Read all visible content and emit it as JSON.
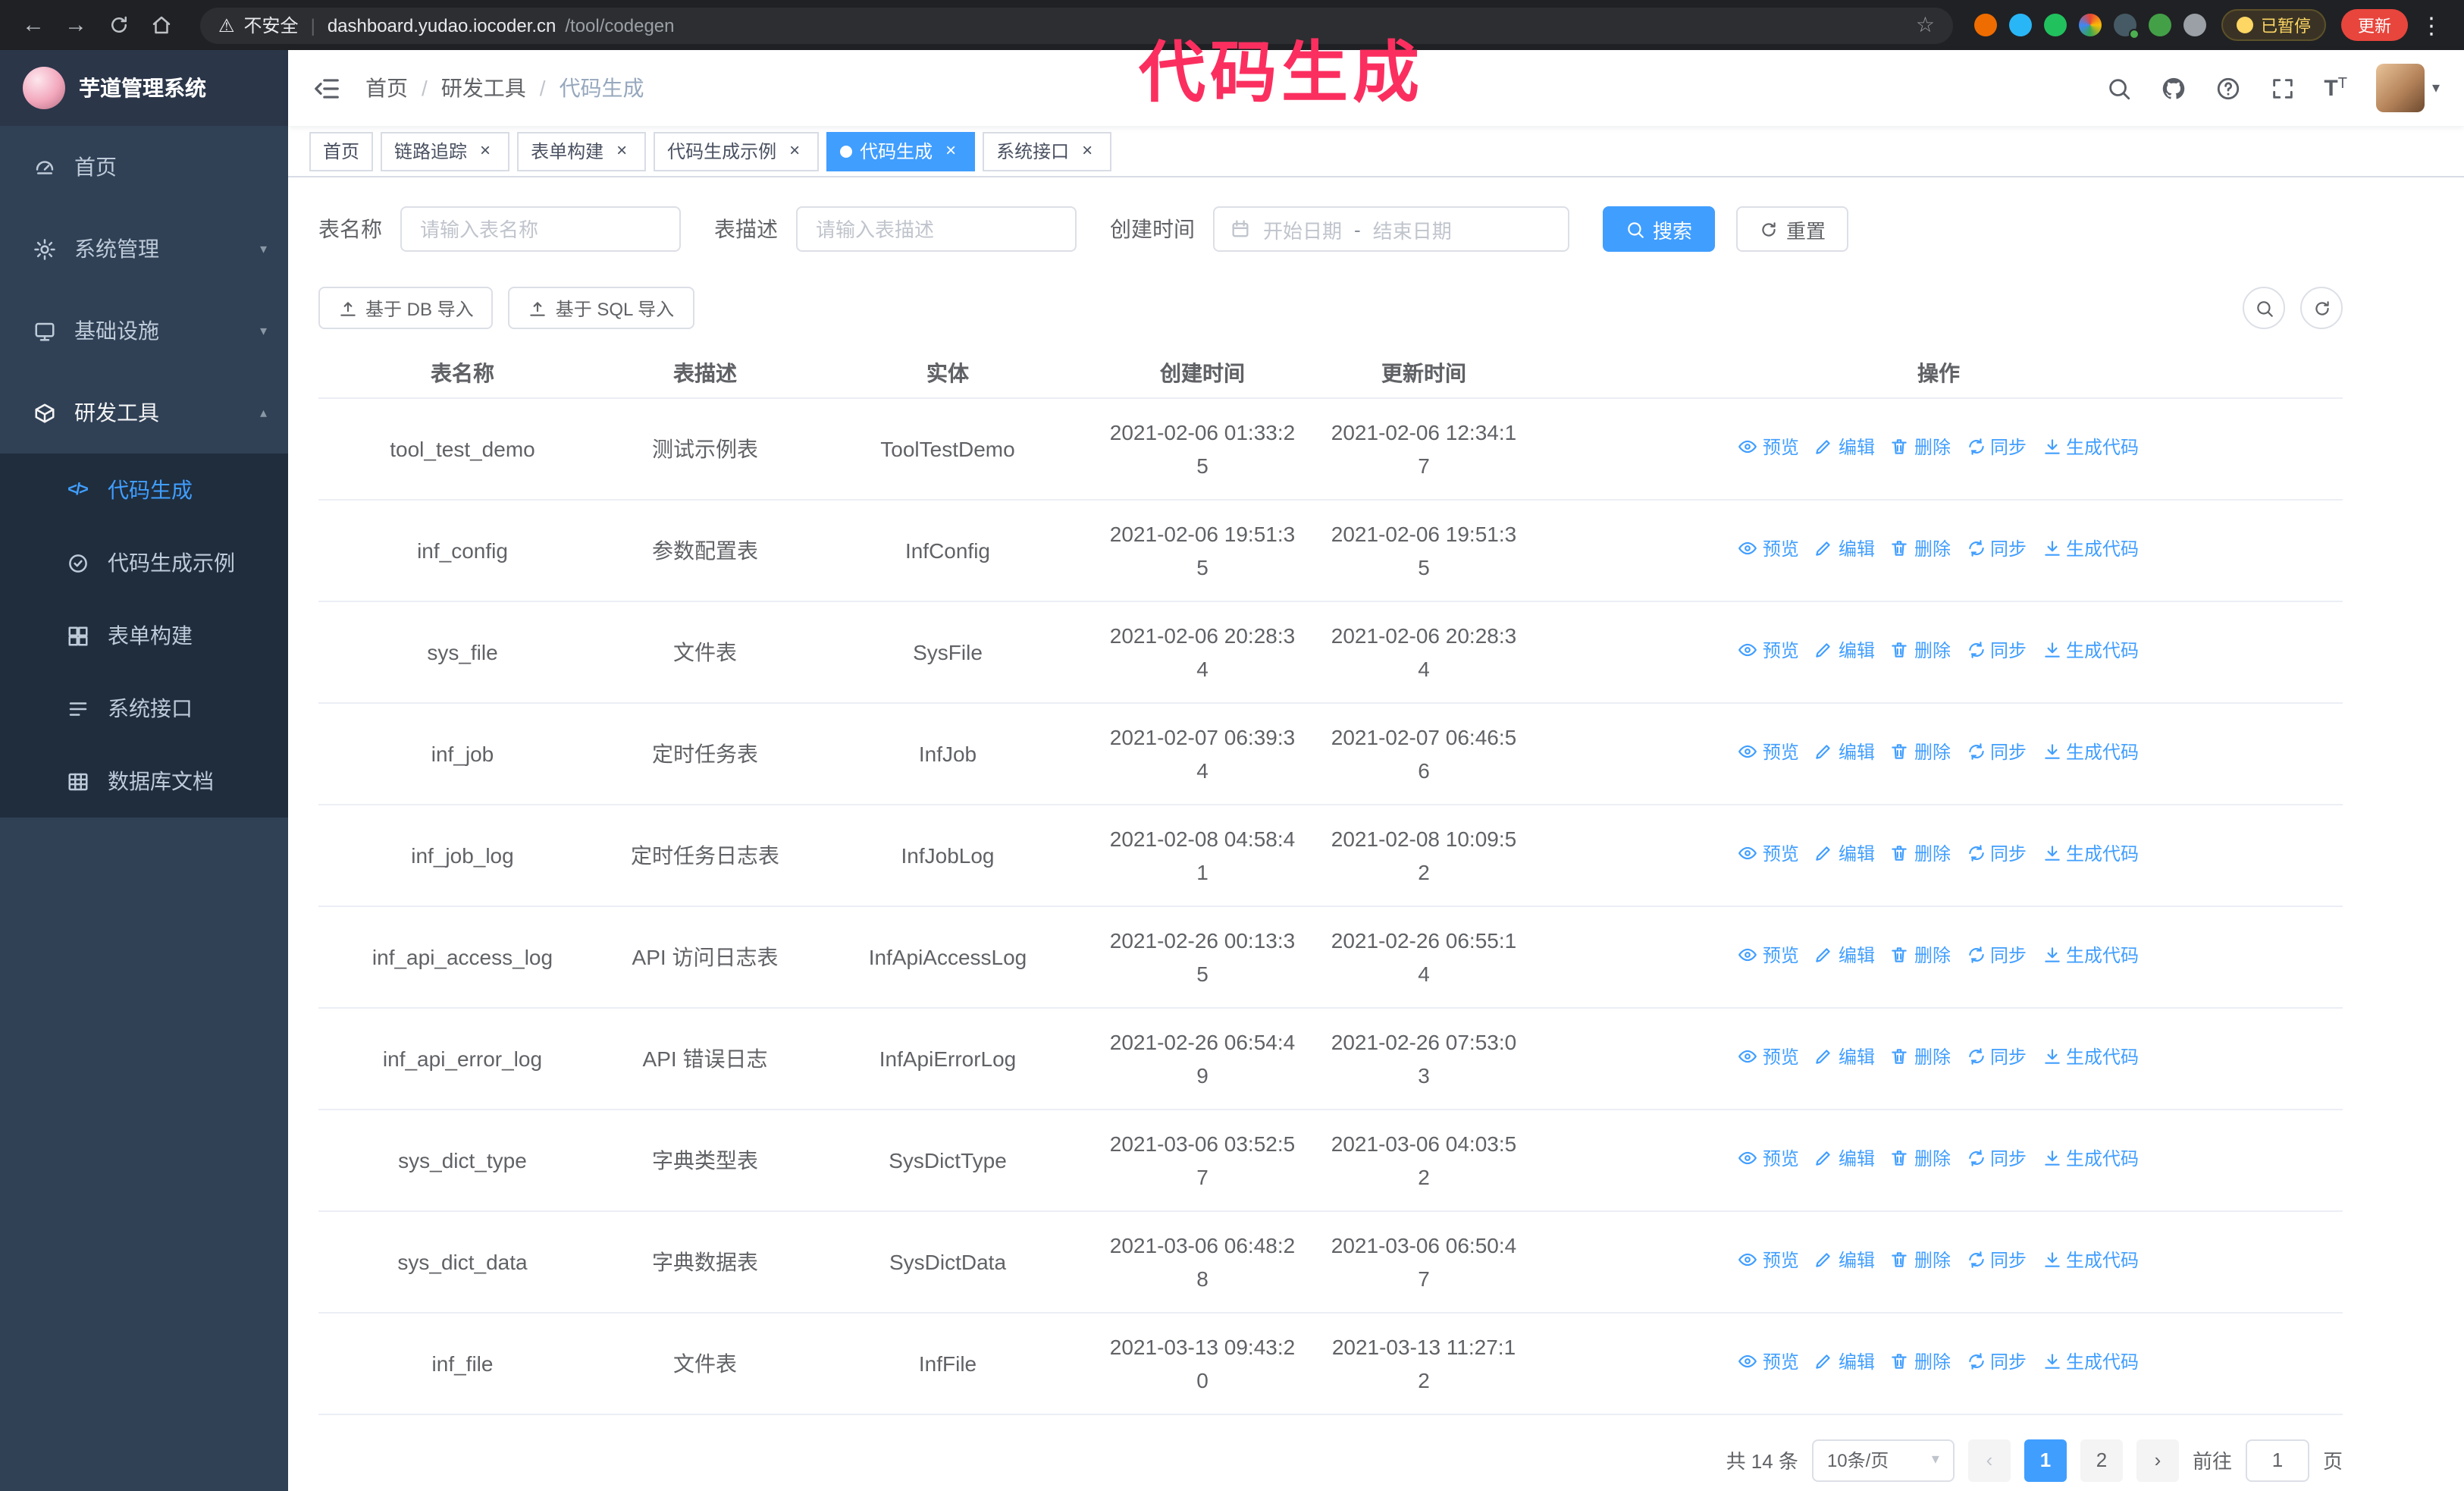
{
  "colors": {
    "accent": "#409eff",
    "annotation": "#fb2f5f",
    "sidebar_bg": "#304156",
    "submenu_bg": "#1f2d3d",
    "tag_active": "#409eff",
    "update_button": "#e8453c",
    "paused_badge": "#fdd663",
    "link": "#409eff"
  },
  "chrome": {
    "security_text": "不安全",
    "url_host": "dashboard.yudao.iocoder.cn",
    "url_path": "/tool/codegen",
    "paused_label": "已暂停",
    "update_label": "更新",
    "extensions": [
      {
        "name": "fox-extension-icon",
        "color": "#ef6c00"
      },
      {
        "name": "drop-extension-icon",
        "color": "#29b6f6"
      },
      {
        "name": "green-check-extension-icon",
        "color": "#21c15e"
      },
      {
        "name": "colorful-extension-icon",
        "color": "conic"
      },
      {
        "name": "badged-extension-icon",
        "color": "#455a64",
        "badge": "#4caf50"
      },
      {
        "name": "leaf-extension-icon",
        "color": "#43a047"
      },
      {
        "name": "pin-extension-icon",
        "color": "#9aa0a6"
      }
    ]
  },
  "overlay": {
    "title": "代码生成"
  },
  "sidebar": {
    "app_title": "芋道管理系统",
    "items": [
      {
        "name": "home",
        "label": "首页",
        "icon": "gauge"
      },
      {
        "name": "system",
        "label": "系统管理",
        "icon": "gear",
        "chevron": "down"
      },
      {
        "name": "infra",
        "label": "基础设施",
        "icon": "monitor",
        "chevron": "down"
      },
      {
        "name": "dev-tools",
        "label": "研发工具",
        "icon": "tool",
        "chevron": "up",
        "expanded": true
      }
    ],
    "subitems": [
      {
        "name": "codegen",
        "label": "代码生成",
        "icon": "code",
        "active": true
      },
      {
        "name": "codegen-demo",
        "label": "代码生成示例",
        "icon": "demo"
      },
      {
        "name": "form-builder",
        "label": "表单构建",
        "icon": "form"
      },
      {
        "name": "api",
        "label": "系统接口",
        "icon": "api"
      },
      {
        "name": "db-doc",
        "label": "数据库文档",
        "icon": "db"
      }
    ]
  },
  "navbar": {
    "breadcrumb": [
      "首页",
      "研发工具",
      "代码生成"
    ]
  },
  "tags": [
    {
      "label": "首页",
      "closable": false,
      "active": false
    },
    {
      "label": "链路追踪",
      "closable": true,
      "active": false
    },
    {
      "label": "表单构建",
      "closable": true,
      "active": false
    },
    {
      "label": "代码生成示例",
      "closable": true,
      "active": false
    },
    {
      "label": "代码生成",
      "closable": true,
      "active": true
    },
    {
      "label": "系统接口",
      "closable": true,
      "active": false
    }
  ],
  "filters": {
    "table_name_label": "表名称",
    "table_name_placeholder": "请输入表名称",
    "table_desc_label": "表描述",
    "table_desc_placeholder": "请输入表描述",
    "create_time_label": "创建时间",
    "date_start_placeholder": "开始日期",
    "date_separator": "-",
    "date_end_placeholder": "结束日期",
    "search_button": "搜索",
    "reset_button": "重置"
  },
  "toolbar": {
    "import_db_label": "基于 DB 导入",
    "import_sql_label": "基于 SQL 导入"
  },
  "table": {
    "columns": [
      "表名称",
      "表描述",
      "实体",
      "创建时间",
      "更新时间",
      "操作"
    ],
    "action_labels": [
      "预览",
      "编辑",
      "删除",
      "同步",
      "生成代码"
    ],
    "rows": [
      {
        "name": "tool_test_demo",
        "desc": "测试示例表",
        "entity": "ToolTestDemo",
        "created": "2021-02-06 01:33:25",
        "updated": "2021-02-06 12:34:17"
      },
      {
        "name": "inf_config",
        "desc": "参数配置表",
        "entity": "InfConfig",
        "created": "2021-02-06 19:51:35",
        "updated": "2021-02-06 19:51:35"
      },
      {
        "name": "sys_file",
        "desc": "文件表",
        "entity": "SysFile",
        "created": "2021-02-06 20:28:34",
        "updated": "2021-02-06 20:28:34"
      },
      {
        "name": "inf_job",
        "desc": "定时任务表",
        "entity": "InfJob",
        "created": "2021-02-07 06:39:34",
        "updated": "2021-02-07 06:46:56"
      },
      {
        "name": "inf_job_log",
        "desc": "定时任务日志表",
        "entity": "InfJobLog",
        "created": "2021-02-08 04:58:41",
        "updated": "2021-02-08 10:09:52"
      },
      {
        "name": "inf_api_access_log",
        "desc": "API 访问日志表",
        "entity": "InfApiAccessLog",
        "created": "2021-02-26 00:13:35",
        "updated": "2021-02-26 06:55:14"
      },
      {
        "name": "inf_api_error_log",
        "desc": "API 错误日志",
        "entity": "InfApiErrorLog",
        "created": "2021-02-26 06:54:49",
        "updated": "2021-02-26 07:53:03"
      },
      {
        "name": "sys_dict_type",
        "desc": "字典类型表",
        "entity": "SysDictType",
        "created": "2021-03-06 03:52:57",
        "updated": "2021-03-06 04:03:52"
      },
      {
        "name": "sys_dict_data",
        "desc": "字典数据表",
        "entity": "SysDictData",
        "created": "2021-03-06 06:48:28",
        "updated": "2021-03-06 06:50:47"
      },
      {
        "name": "inf_file",
        "desc": "文件表",
        "entity": "InfFile",
        "created": "2021-03-13 09:43:20",
        "updated": "2021-03-13 11:27:12"
      }
    ]
  },
  "pagination": {
    "total_label": "共 14 条",
    "page_size_label": "10条/页",
    "pages": [
      "1",
      "2"
    ],
    "active_page": "1",
    "goto_prefix": "前往",
    "goto_value": "1",
    "goto_suffix": "页"
  }
}
